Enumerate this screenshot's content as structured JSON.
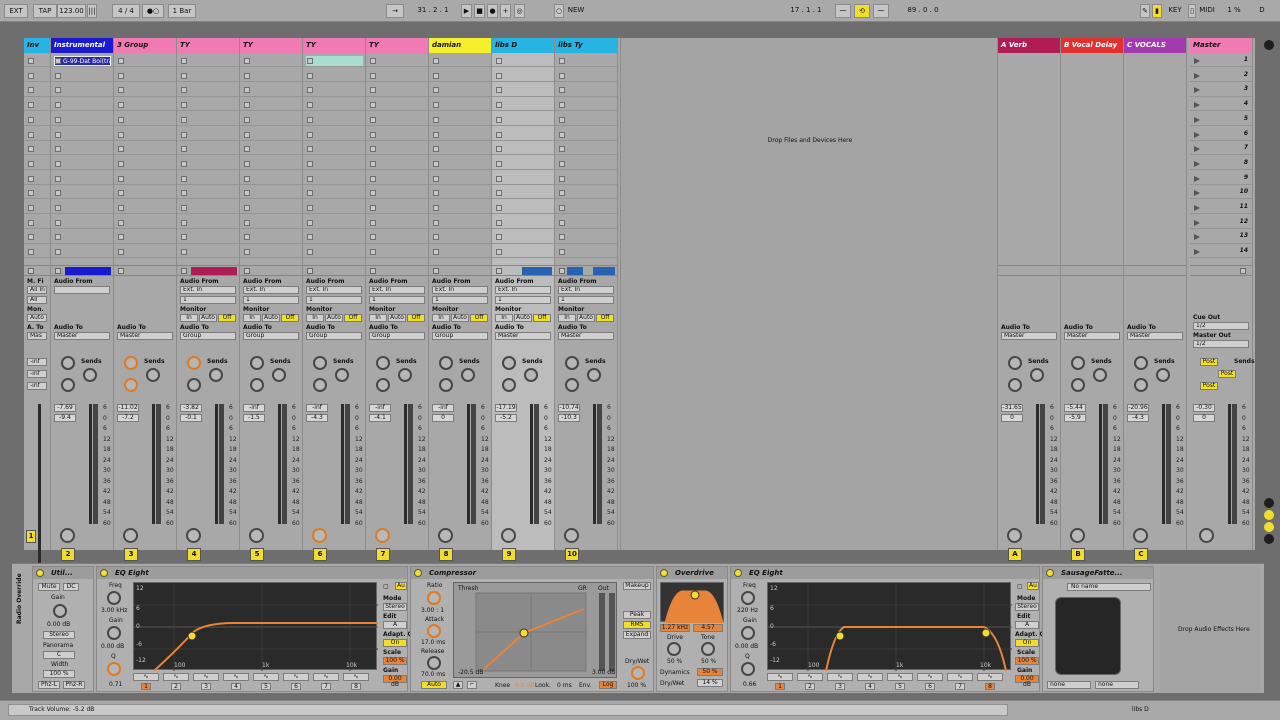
{
  "transport": {
    "ext": "EXT",
    "tap": "TAP",
    "tempo": "123.00",
    "sig_num": "4",
    "sig_den": "4",
    "quant": "1 Bar",
    "pos_bar": "31",
    "pos_beat": "2",
    "pos_sixteenth": "1",
    "new_label": "NEW",
    "loop_start_bar": "17",
    "loop_start_beat": "1",
    "loop_start_16": "1",
    "loop_len_bar": "89",
    "loop_len_beat": "0",
    "loop_len_16": "0",
    "key_label": "KEY",
    "midi_label": "MIDI",
    "cpu": "1 %",
    "disk": "D"
  },
  "tracks": [
    {
      "name": "Inv",
      "color": "#27b4e2",
      "mixer_a": "",
      "mixer_b": "",
      "num": "",
      "short": true
    },
    {
      "name": "Instrumental",
      "color": "#1a1ad1",
      "clip": "G-99-Dat Boi(tra",
      "audio_to": "Master",
      "vol": "-7.69",
      "peak": "-9.4",
      "num": "2"
    },
    {
      "name": "3 Group",
      "color": "#f27ab4",
      "audio_to": "Master",
      "vol": "-11.02",
      "peak": "-7.2",
      "num": "3"
    },
    {
      "name": "TY",
      "color": "#f27ab4",
      "audio_from": "Ext. In",
      "in_ch": "1",
      "audio_to": "Group",
      "vol": "-3.82",
      "peak": "-0.1",
      "num": "4"
    },
    {
      "name": "TY",
      "color": "#f27ab4",
      "audio_from": "Ext. In",
      "in_ch": "1",
      "audio_to": "Group",
      "vol": "-inf",
      "peak": "-1.5",
      "num": "5"
    },
    {
      "name": "TY",
      "color": "#f27ab4",
      "audio_from": "Ext. In",
      "in_ch": "1",
      "audio_to": "Group",
      "vol": "-inf",
      "peak": "-4.3",
      "num": "6"
    },
    {
      "name": "TY",
      "color": "#f27ab4",
      "audio_from": "Ext. In",
      "in_ch": "1",
      "audio_to": "Group",
      "vol": "-inf",
      "peak": "-4.1",
      "num": "7"
    },
    {
      "name": "damian",
      "color": "#f6f02c",
      "audio_from": "Ext. In",
      "in_ch": "1",
      "audio_to": "Group",
      "vol": "-inf",
      "peak": "0",
      "num": "8"
    },
    {
      "name": "libs D",
      "color": "#27b4e2",
      "audio_from": "Ext. In",
      "in_ch": "1",
      "audio_to": "Master",
      "vol": "-17.19",
      "peak": "-5.2",
      "num": "9"
    },
    {
      "name": "libs Ty",
      "color": "#27b4e2",
      "audio_from": "Ext. In",
      "in_ch": "1",
      "audio_to": "Master",
      "vol": "-10.74",
      "peak": "-10.3",
      "num": "10"
    }
  ],
  "labels": {
    "audio_from": "Audio From",
    "monitor": "Monitor",
    "audio_to": "Audio To",
    "sends": "Sends",
    "in": "In",
    "auto": "Auto",
    "off": "Off",
    "solo": "S",
    "drop_files": "Drop Files and Devices Here",
    "drop_audio_effects": "Drop Audio Effects Here",
    "cue_out": "Cue Out",
    "master_out": "Master Out",
    "post": "Post",
    "mfi": "M. Fi",
    "all_in": "All In",
    "all_ch": "All",
    "mon": "Mon.",
    "auto2": "Auto",
    "a_to": "A. To",
    "mas": "Mas",
    "neg_inf": "-inf"
  },
  "returns": [
    {
      "name": "A Verb",
      "color": "#b01c56",
      "audio_to": "Master",
      "vol": "-31.65",
      "peak": "0",
      "num": "A"
    },
    {
      "name": "B Vocal Delay",
      "color": "#e03030",
      "audio_to": "Master",
      "vol": "-5.44",
      "peak": "-5.9",
      "num": "B"
    },
    {
      "name": "C VOCALS",
      "color": "#a33ab0",
      "audio_to": "Master",
      "vol": "-20.96",
      "peak": "-4.3",
      "num": "C"
    }
  ],
  "master": {
    "name": "Master",
    "color": "#f27ab4",
    "cue_out": "1/2",
    "master_out": "1/2",
    "vol": "-0.30",
    "peak": "0",
    "scenes": [
      "1",
      "2",
      "3",
      "4",
      "5",
      "6",
      "7",
      "8",
      "9",
      "10",
      "11",
      "12",
      "13",
      "14"
    ]
  },
  "scale_marks": [
    "6",
    "0",
    "6",
    "12",
    "18",
    "24",
    "30",
    "36",
    "42",
    "48",
    "54",
    "60"
  ],
  "devices": {
    "utility": {
      "title": "Util...",
      "mute": "Mute",
      "dc": "DC",
      "gain_label": "Gain",
      "gain_val": "0.00 dB",
      "mode": "Stereo",
      "panorama": "Panorama",
      "pan_val": "C",
      "width_label": "Width",
      "width_val": "100 %",
      "phz_l": "Phz-L",
      "phz_r": "Phz-R",
      "rack_label": "Radio Override"
    },
    "eq1": {
      "title": "EQ Eight",
      "freq_label": "Freq",
      "freq_val": "3.00 kHz",
      "gain_label": "Gain",
      "gain_val": "0.00 dB",
      "q_label": "Q",
      "q_val": "0.71",
      "mode_label": "Mode",
      "mode_val": "Stereo",
      "edit_label": "Edit",
      "edit_val": "A",
      "adapt_label": "Adapt. Q",
      "adapt_val": "On",
      "scale_label": "Scale",
      "scale_val": "100 %",
      "gain2_label": "Gain",
      "gain2_val": "0.00 dB",
      "ax_100": "100",
      "ax_1k": "1k",
      "ax_10k": "10k",
      "db_12": "12",
      "db_6": "6",
      "db_0": "0",
      "db_m6": "-6",
      "db_m12": "-12",
      "band_nums": [
        "1",
        "2",
        "3",
        "4",
        "5",
        "6",
        "7",
        "8"
      ],
      "audio_label": "Au"
    },
    "compressor": {
      "title": "Compressor",
      "ratio_label": "Ratio",
      "ratio_val": "3.00 : 1",
      "attack_label": "Attack",
      "attack_val": "17.0 ms",
      "release_label": "Release",
      "release_val": "70.0 ms",
      "auto": "Auto",
      "thresh_label": "Thresh",
      "gr_label": "GR",
      "out_label": "Out",
      "thresh_val": "-20.5 dB",
      "out_val": "3.00 dB",
      "makeup": "Makeup",
      "peak": "Peak",
      "rms": "RMS",
      "expand": "Expand",
      "drywet_label": "Dry/Wet",
      "drywet_val": "100 %",
      "knee_label": "Knee",
      "knee_val": "6.0 dB",
      "look_label": "Look.",
      "look_val": "0 ms",
      "env_label": "Env.",
      "env_val": "Log"
    },
    "overdrive": {
      "title": "Overdrive",
      "freq_val": "1.27 kHz",
      "bw_val": "4.57",
      "drive_label": "Drive",
      "drive_val": "50 %",
      "tone_label": "Tone",
      "tone_val": "50 %",
      "dynamics_label": "Dynamics",
      "dynamics_val": "50 %",
      "drywet_label": "Dry/Wet",
      "drywet_val": "14 %"
    },
    "eq2": {
      "title": "EQ Eight",
      "freq_label": "Freq",
      "freq_val": "220 Hz",
      "gain_label": "Gain",
      "gain_val": "0.00 dB",
      "q_label": "Q",
      "q_val": "0.66",
      "mode_label": "Mode",
      "mode_val": "Stereo",
      "edit_label": "Edit",
      "edit_val": "A",
      "adapt_label": "Adapt. Q",
      "adapt_val": "On",
      "scale_label": "Scale",
      "scale_val": "100 %",
      "gain2_label": "Gain",
      "gain2_val": "0.00 dB",
      "ax_100": "100",
      "ax_1k": "1k",
      "ax_10k": "10k",
      "db_12": "12",
      "db_6": "6",
      "db_0": "0",
      "db_m6": "-6",
      "db_m12": "-12",
      "band_nums": [
        "1",
        "2",
        "3",
        "4",
        "5",
        "6",
        "7",
        "8"
      ],
      "audio_label": "Au"
    },
    "sausage": {
      "title": "SausageFatte...",
      "preset": "No name",
      "sel_a": "none",
      "sel_b": "none"
    }
  },
  "status": {
    "text": "Track Volume: -5.2 dB",
    "track": "libs D"
  }
}
